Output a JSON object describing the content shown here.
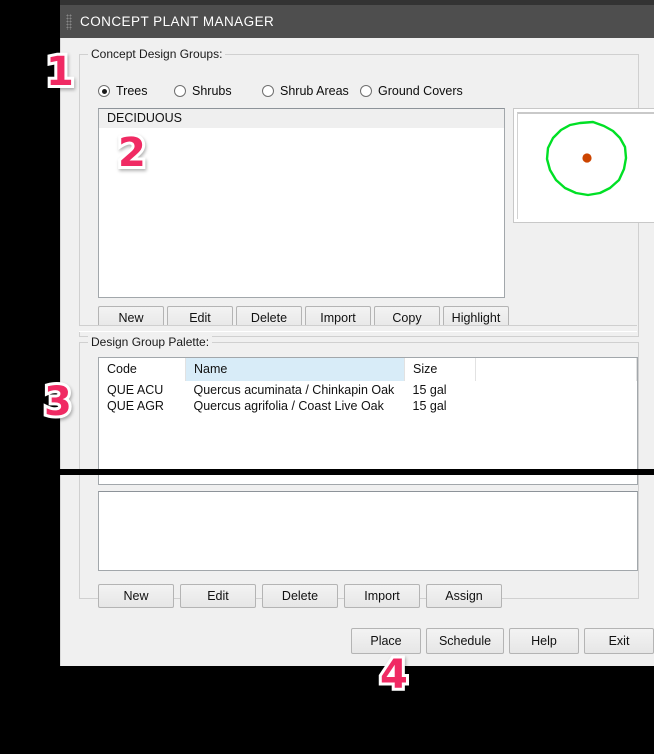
{
  "window": {
    "title": "CONCEPT PLANT MANAGER",
    "grip_icon": "drag-grip-dots-icon",
    "titlebar_color": "#4e4e4e",
    "background_color": "#f0f0f0"
  },
  "design_groups": {
    "legend": "Concept Design Groups:",
    "radios": [
      {
        "label": "Trees",
        "selected": true
      },
      {
        "label": "Shrubs",
        "selected": false
      },
      {
        "label": "Shrub Areas",
        "selected": false
      },
      {
        "label": "Ground Covers",
        "selected": false
      }
    ],
    "list_items": [
      {
        "label": "DECIDUOUS",
        "selected": true
      }
    ],
    "buttons": [
      "New",
      "Edit",
      "Delete",
      "Import",
      "Copy",
      "Highlight"
    ]
  },
  "preview": {
    "name": "tree-symbol-preview",
    "outline_color": "#00e025",
    "center_dot_color": "#cc4400",
    "background_color": "#ffffff"
  },
  "palette": {
    "legend": "Design Group Palette:",
    "columns": [
      "Code",
      "Name",
      "Size"
    ],
    "highlighted_column": "Name",
    "highlight_color": "#d8ecf8",
    "rows": [
      {
        "code": "QUE ACU",
        "name": "Quercus acuminata / Chinkapin Oak",
        "size": "15 gal"
      },
      {
        "code": "QUE AGR",
        "name": "Quercus agrifolia / Coast Live Oak",
        "size": "15 gal"
      }
    ]
  },
  "lower_panel": {
    "list_items": [],
    "buttons": [
      "New",
      "Edit",
      "Delete",
      "Import",
      "Assign"
    ]
  },
  "footer": {
    "buttons": [
      "Place",
      "Schedule",
      "Help",
      "Exit"
    ]
  },
  "annotations": [
    {
      "number": "1",
      "color": "#f02a63"
    },
    {
      "number": "2",
      "color": "#f02a63"
    },
    {
      "number": "3",
      "color": "#f02a63"
    },
    {
      "number": "4",
      "color": "#f02a63"
    }
  ]
}
